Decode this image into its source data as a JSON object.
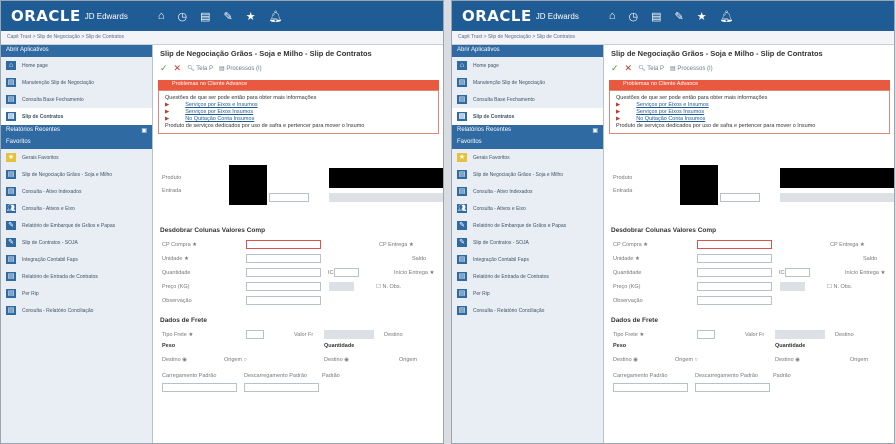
{
  "brand": {
    "logo": "ORACLE",
    "sub": "JD Edwards"
  },
  "top_icons": [
    "home-icon",
    "clock-icon",
    "grid-icon",
    "edit-icon",
    "star-icon",
    "bell-icon"
  ],
  "breadcrumb": "Capit Trust > Slip de Negociação > Slip de Contratos",
  "sidebar": {
    "open_apps": "Abrir Aplicativos",
    "items": [
      {
        "label": "Home page",
        "icon": "home-icon"
      },
      {
        "label": "Manutenção Slip de Negociação",
        "icon": "doc-icon"
      },
      {
        "label": "Consulta Base Fechamento",
        "icon": "doc-icon"
      },
      {
        "label": "Slip de Contratos",
        "icon": "doc-icon",
        "selected": true
      }
    ],
    "recent": "Relatórios Recentes",
    "favorites": "Favoritos",
    "fav_items": [
      {
        "label": "Gerais Favoritos",
        "icon": "star-icon"
      },
      {
        "label": "Slip de Negociação Grãos - Soja e Milho",
        "icon": "doc-icon"
      },
      {
        "label": "Consulta - Ativo Indexados",
        "icon": "doc-icon"
      },
      {
        "label": "Consulta - Ativos e Eixo",
        "icon": "users-icon"
      },
      {
        "label": "Relatório de Embarque de Grãos e Papas",
        "icon": "edit-icon"
      },
      {
        "label": "Slip de Contratos - SOJA",
        "icon": "edit-icon"
      },
      {
        "label": "Integração Contabil Faps",
        "icon": "doc-icon"
      },
      {
        "label": "Relatório de Entrada de Contratos",
        "icon": "doc-icon"
      },
      {
        "label": "Per Rip",
        "icon": "doc-icon"
      },
      {
        "label": "Consulta - Relatório Conciliação",
        "icon": "doc-icon"
      }
    ]
  },
  "form": {
    "title": "Slip de Negociação Grãos - Soja e Milho - Slip de Contratos",
    "toolbar": {
      "ok": "✓",
      "cancel": "✕",
      "find": "Tela P",
      "forms": "Processos (I)"
    },
    "error_title": "Problemas no Cliente Advance",
    "error_msg": "Questões de que ser pode então para obter mais informações",
    "links": [
      "Serviços por Eixos e Insumos",
      "Serviços por Eixos Insumos",
      "No Quitação Conta Insumos"
    ],
    "footer_msg": "Produto de serviços dedicados por uso de safra e pertencer para mover o Insumo",
    "fields": {
      "produto": "Produto",
      "entrada": "Entrada"
    },
    "section1": "Desdobrar Colunas Valores Comp",
    "labels": {
      "cp_compra": "CP Compra ★",
      "cp_entrega": "CP Entrega ★",
      "unidade": "Unidade ★",
      "saldo": "Saldo",
      "quantidade": "Quantidade",
      "icms": "ICMS",
      "inicio_entrega": "Início Entrega ★",
      "preco": "Preço (KG)",
      "n_obs": "N. Obs.",
      "observacao": "Observação"
    },
    "section2": "Dados de Frete",
    "frete_labels": {
      "tipo_frete": "Tipo Frete ★",
      "valor_frete": "Valor Fr",
      "destino": "Destino",
      "peso": "Peso",
      "quantidade": "Quantidade",
      "destino_opt": "Destino",
      "origem_opt": "Origem",
      "destino_opt2": "Destino",
      "origem_opt2": "Origem",
      "carregamento": "Carregamento Padrão",
      "descarregamento": "Descarregamento Padrão",
      "padrao": "Padrão"
    }
  },
  "colors": {
    "header": "#1f5b94",
    "section": "#2f6aa3",
    "error": "#e8593f"
  }
}
